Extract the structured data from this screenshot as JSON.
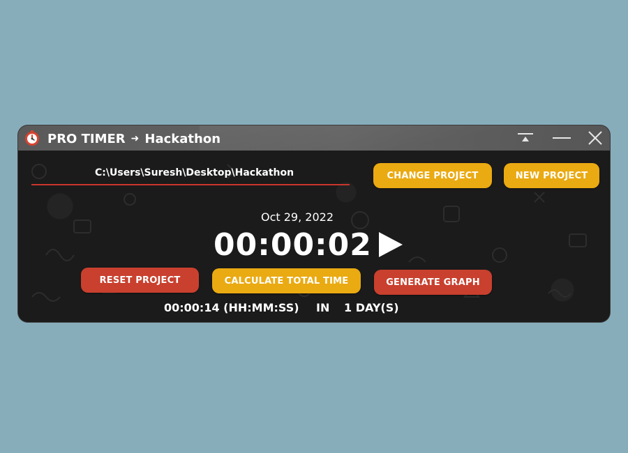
{
  "window": {
    "app_name": "PRO TIMER",
    "project_name": "Hackathon",
    "title_arrow_icon": "arrow-right-icon",
    "app_icon": "stopwatch-icon"
  },
  "controls": {
    "pin_icon": "pin-to-top-icon",
    "minimize_icon": "minimize-icon",
    "close_icon": "close-icon"
  },
  "project": {
    "path": "C:\\Users\\Suresh\\Desktop\\Hackathon",
    "change_label": "CHANGE PROJECT",
    "new_label": "NEW PROJECT"
  },
  "timer": {
    "date": "Oct 29, 2022",
    "elapsed": "00:00:02",
    "play_icon": "play-icon"
  },
  "actions": {
    "reset_label": "RESET PROJECT",
    "calculate_label": "CALCULATE TOTAL TIME",
    "graph_label": "GENERATE GRAPH"
  },
  "summary": {
    "total_time": "00:00:14 (HH:MM:SS)",
    "in_label": "IN",
    "days": "1 DAY(S)"
  },
  "colors": {
    "accent_yellow": "#eaaa12",
    "accent_red": "#c9402e",
    "underline_red": "#c9362c",
    "background": "#87adbb",
    "window_bg": "#1b1b1b",
    "titlebar_bg": "#5f5f5f"
  }
}
